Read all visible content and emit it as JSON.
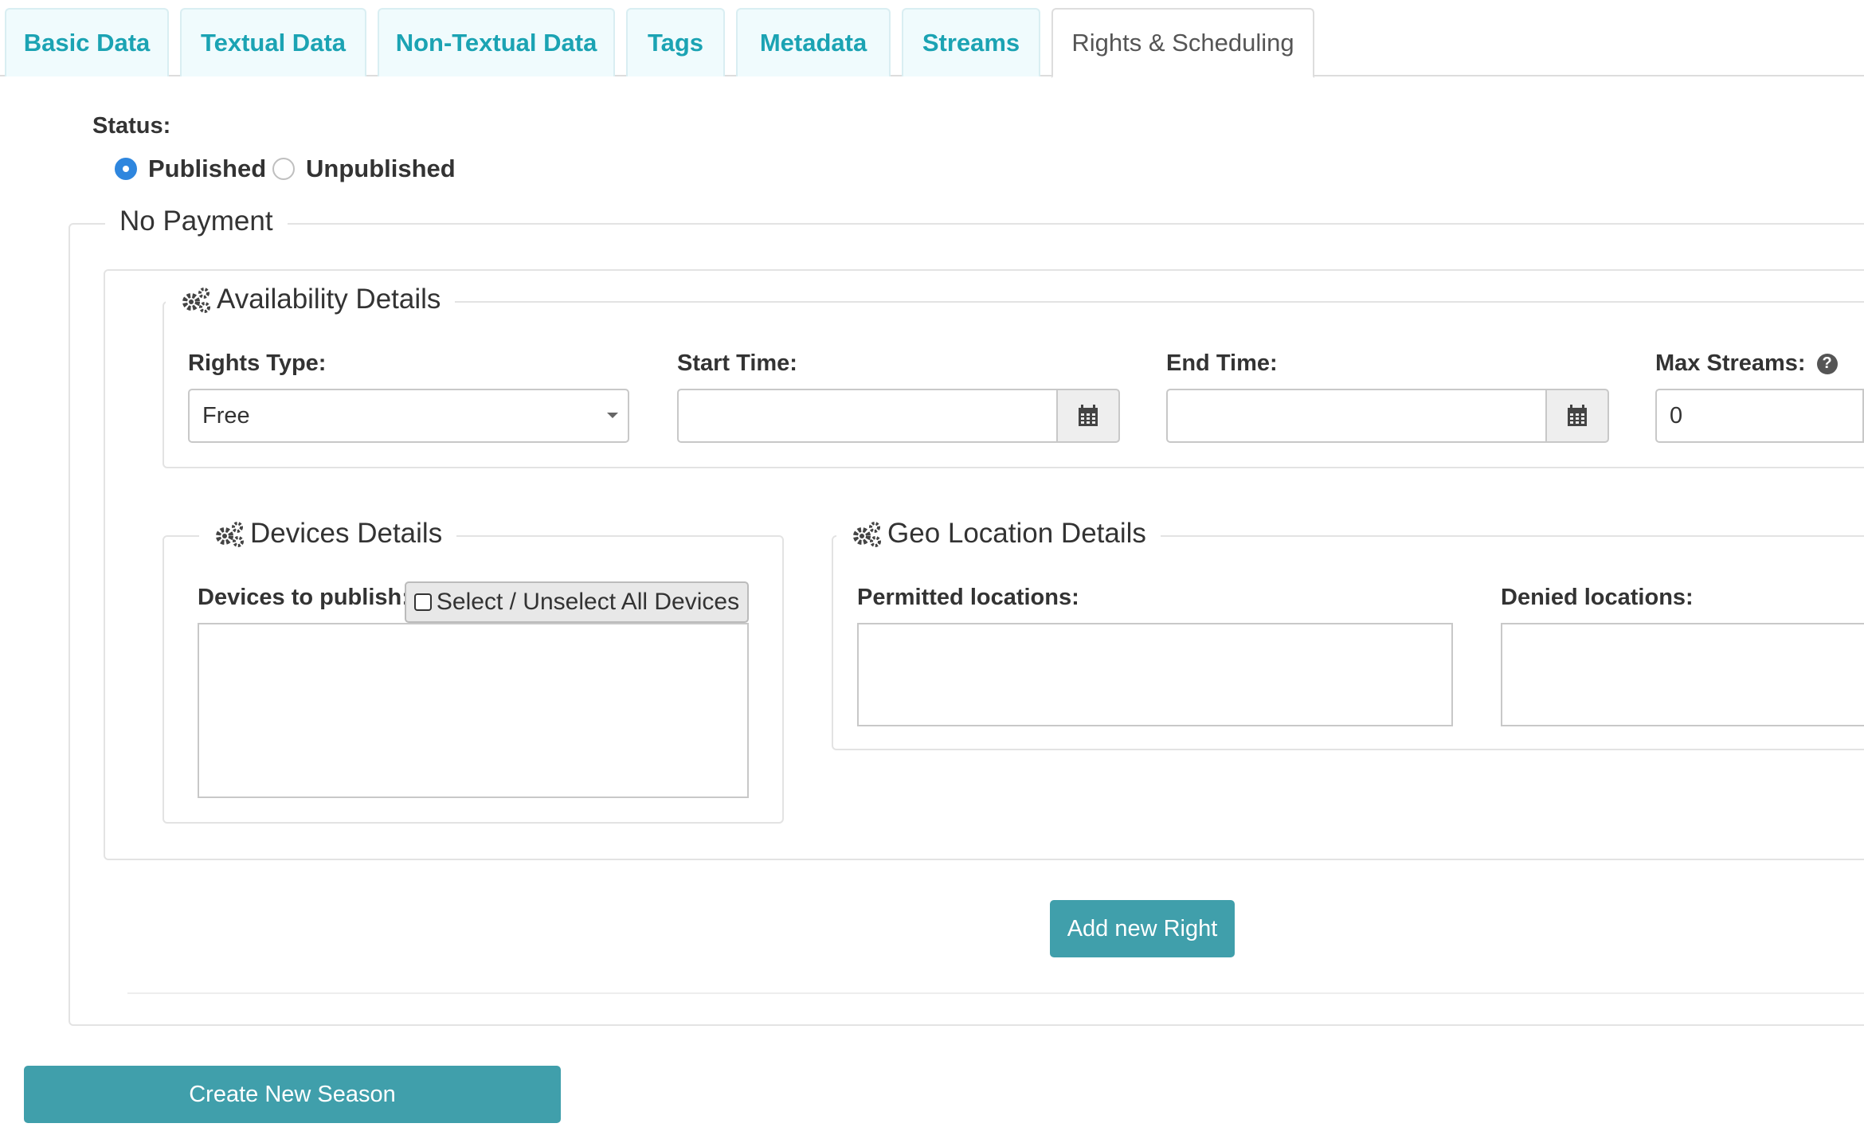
{
  "tabs": [
    {
      "label": "Basic Data"
    },
    {
      "label": "Textual Data"
    },
    {
      "label": "Non-Textual Data"
    },
    {
      "label": "Tags"
    },
    {
      "label": "Metadata"
    },
    {
      "label": "Streams"
    },
    {
      "label": "Rights & Scheduling",
      "active": true
    }
  ],
  "status": {
    "label": "Status:",
    "options": [
      "Published",
      "Unpublished"
    ],
    "selected": "Published"
  },
  "payment_legend": "No Payment",
  "availability": {
    "legend": "Availability Details",
    "rights_type_label": "Rights Type:",
    "rights_type_value": "Free",
    "start_time_label": "Start Time:",
    "start_time_value": "",
    "end_time_label": "End Time:",
    "end_time_value": "",
    "max_streams_label": "Max Streams:",
    "max_streams_value": "0"
  },
  "devices": {
    "legend": "Devices Details",
    "label": "Devices to publish:",
    "select_all_label": "Select / Unselect All Devices"
  },
  "geo": {
    "legend": "Geo Location Details",
    "permitted_label": "Permitted locations:",
    "denied_label": "Denied locations:"
  },
  "buttons": {
    "add_right": "Add new Right",
    "create_season": "Create New Season"
  },
  "colors": {
    "accent": "#409fab",
    "tab_text": "#1ba3b3",
    "radio_selected": "#2e86de"
  },
  "icons": {
    "legend_icon": "gears-icon",
    "date_addon_icon": "calendar-icon",
    "select_caret": "caret-down-icon",
    "help": "question-circle-icon"
  }
}
